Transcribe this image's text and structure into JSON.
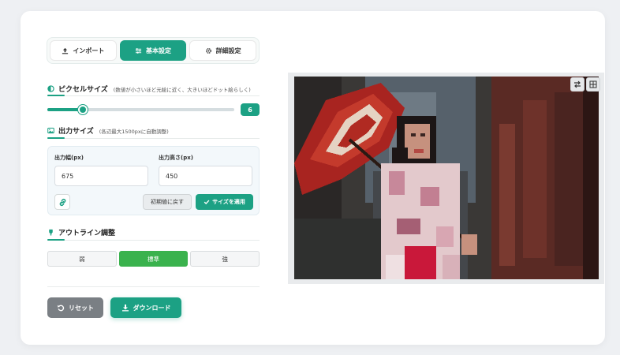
{
  "tabs": [
    {
      "label": "インポート",
      "icon": "upload-icon"
    },
    {
      "label": "基本設定",
      "icon": "sliders-icon",
      "active": true
    },
    {
      "label": "詳細設定",
      "icon": "gear-icon"
    }
  ],
  "pixel_size": {
    "title": "ピクセルサイズ",
    "note": "(数値が小さいほど元絵に近く、大きいほどドット絵らしく)",
    "value": "6",
    "fill_percent": 19
  },
  "output_size": {
    "title": "出力サイズ",
    "note": "(各辺最大1500pxに自動調整)",
    "width_label": "出力幅(px)",
    "width_value": "675",
    "height_label": "出力高さ(px)",
    "height_value": "450",
    "reset_label": "初期値に戻す",
    "apply_label": "サイズを適用"
  },
  "outline": {
    "title": "アウトライン調整",
    "options": [
      "弱",
      "標準",
      "強"
    ],
    "selected": "標準"
  },
  "actions": {
    "reset_label": "リセット",
    "download_label": "ダウンロード"
  },
  "preview": {
    "image": "pixelated-photo-of-woman-in-kimono-with-red-parasol",
    "tools": [
      "swap-icon",
      "grid-icon"
    ]
  },
  "colors": {
    "accent": "#1ca184",
    "outline_active": "#3ab24d",
    "reset_button": "#7a7f84"
  }
}
